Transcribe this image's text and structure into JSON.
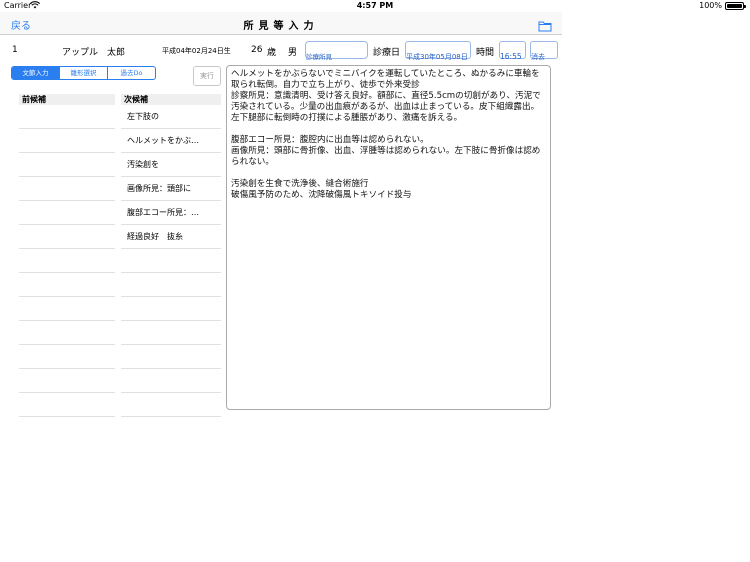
{
  "status": {
    "carrier": "Carrier",
    "time": "4:57 PM",
    "battery": "100%"
  },
  "nav": {
    "back": "戻る",
    "title": "所見等入力"
  },
  "patient": {
    "id": "1",
    "name": "アップル　太郎",
    "dob": "平成04年02月24日生",
    "age": "26",
    "age_unit": "歳",
    "sex": "男",
    "finding_button": "診療所見",
    "exam_date_label": "診療日",
    "exam_date": "平成30年05月08日",
    "time_label": "時間",
    "time": "16:55",
    "delete": "消去"
  },
  "segments": [
    {
      "label": "文節入力",
      "active": true
    },
    {
      "label": "雛形選択",
      "active": false
    },
    {
      "label": "過去Do",
      "active": false
    }
  ],
  "exec": "実行",
  "prev_candidates": {
    "header": "前候補",
    "items": [
      "",
      "",
      "",
      "",
      "",
      "",
      "",
      "",
      "",
      "",
      "",
      "",
      ""
    ]
  },
  "next_candidates": {
    "header": "次候補",
    "items": [
      "左下肢の",
      "ヘルメットをかぶ…",
      "汚染創を",
      "画像所見：頭部に",
      "腹部エコー所見：…",
      "経過良好　抜糸",
      "",
      "",
      "",
      "",
      "",
      "",
      ""
    ]
  },
  "memo": "ヘルメットをかぶらないでミニバイクを運転していたところ、ぬかるみに車輪を取られ転倒。自力で立ち上がり、徒歩で外来受診\n診察所見：意識清明、受け答え良好。額部に、直径5.5cmの切創があり、汚泥で汚染されている。少量の出血痕があるが、出血は止まっている。皮下組織露出。左下腿部に転倒時の打撲による腫脹があり、激痛を訴える。\n\n腹部エコー所見：腹腔内に出血等は認められない。\n画像所見：頭部に骨折像、出血、浮腫等は認められない。左下肢に骨折像は認められない。\n\n汚染創を生食で洗浄後、縫合術施行\n破傷風予防のため、沈降破傷風トキソイド投与"
}
